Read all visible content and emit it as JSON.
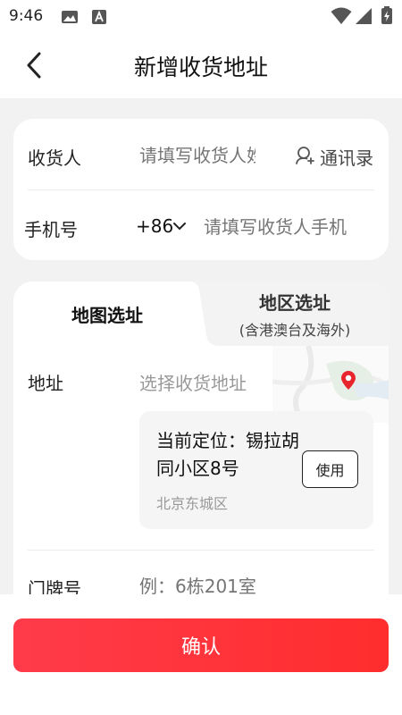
{
  "status_bar": {
    "time": "9:46"
  },
  "nav": {
    "title": "新增收货地址"
  },
  "receiver": {
    "label": "收货人",
    "placeholder": "请填写收货人姓名",
    "contacts_label": "通讯录"
  },
  "phone": {
    "label": "手机号",
    "country_code": "+86",
    "placeholder": "请填写收货人手机号"
  },
  "tabs": {
    "map_label": "地图选址",
    "region_label": "地区选址",
    "region_sub": "(含港澳台及海外)"
  },
  "address": {
    "label": "地址",
    "placeholder": "选择收货地址",
    "current_location": "当前定位：锡拉胡同小区8号",
    "city": "北京东城区",
    "use_label": "使用"
  },
  "house_number": {
    "label": "门牌号",
    "placeholder": "例：6栋201室"
  },
  "confirm_label": "确认",
  "colors": {
    "accent": "#ff2d2d",
    "pin": "#e8242d"
  }
}
